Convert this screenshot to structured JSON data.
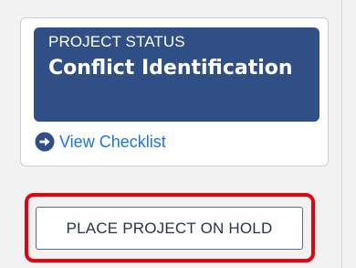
{
  "status_card": {
    "label": "PROJECT STATUS",
    "value": "Conflict Identification",
    "link_icon": "arrow-right-circle-icon",
    "link_text": "View Checklist"
  },
  "actions": {
    "hold_button_label": "PLACE PROJECT ON HOLD"
  },
  "colors": {
    "banner": "#2f4f86",
    "link": "#1a73e8",
    "highlight": "#e8000b",
    "button_text": "#27344d"
  }
}
